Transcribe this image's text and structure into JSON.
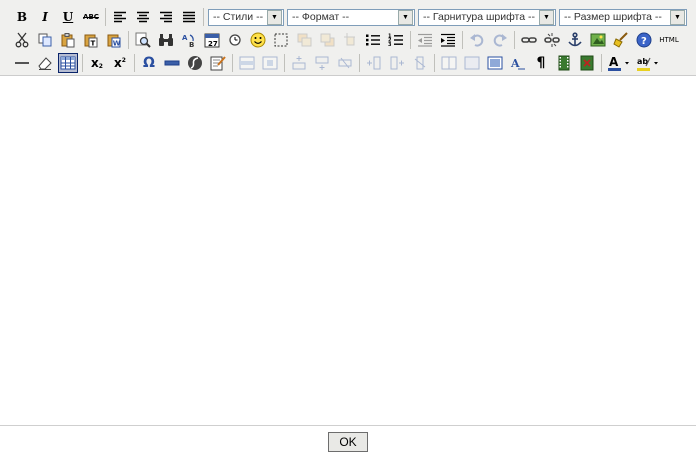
{
  "toolbar": {
    "row1": {
      "bold": "B",
      "italic": "I",
      "underline": "U",
      "strike": "ABC",
      "styles": "-- Стили --",
      "format": "-- Формат --",
      "fontname": "-- Гарнитура шрифта --",
      "fontsize": "-- Размер шрифта --"
    },
    "row2": {
      "html": "HTML"
    },
    "row3": {
      "subscript": "x",
      "superscript": "x",
      "omega": "Ω",
      "pilcrow": "¶"
    }
  },
  "footer": {
    "ok": "OK"
  }
}
